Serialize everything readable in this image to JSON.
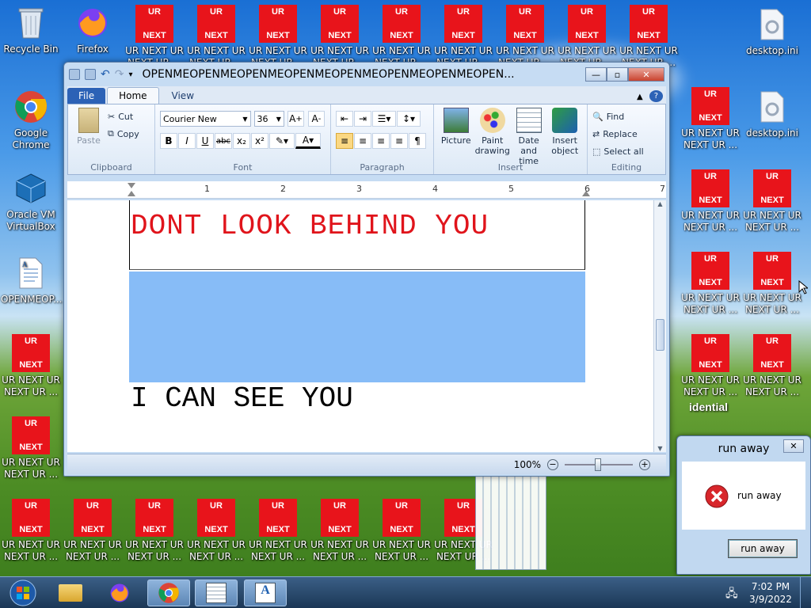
{
  "desktop": {
    "system_icons": [
      {
        "label": "Recycle Bin",
        "icon": "recycle-bin-icon"
      },
      {
        "label": "Firefox",
        "icon": "firefox-icon"
      },
      {
        "label": "Google Chrome",
        "icon": "chrome-icon"
      },
      {
        "label": "Oracle VM VirtualBox",
        "icon": "virtualbox-icon"
      },
      {
        "label": "OPENMEOP...",
        "icon": "document-file-icon"
      },
      {
        "label": "desktop.ini",
        "icon": "settings-file-icon"
      }
    ],
    "ur_icon": {
      "top_text": "UR",
      "bottom_text": "NEXT",
      "label": "UR NEXT UR NEXT UR ...",
      "color": "#e8141b"
    },
    "partial_text": "idential"
  },
  "wordpad": {
    "title": "OPENMEOPENMEOPENMEOPENMEOPENMEOPENMEOPENMEOPEN...",
    "tabs": {
      "file": "File",
      "home": "Home",
      "view": "View"
    },
    "clipboard": {
      "paste": "Paste",
      "cut": "Cut",
      "copy": "Copy",
      "label": "Clipboard"
    },
    "font": {
      "family": "Courier New",
      "size": "36",
      "label": "Font"
    },
    "paragraph": {
      "label": "Paragraph"
    },
    "insert": {
      "picture": "Picture",
      "paint": "Paint drawing",
      "datetime": "Date and time",
      "object": "Insert object",
      "label": "Insert"
    },
    "editing": {
      "find": "Find",
      "replace": "Replace",
      "select_all": "Select all",
      "label": "Editing"
    },
    "ruler": [
      "1",
      "2",
      "3",
      "4",
      "5",
      "6",
      "7"
    ],
    "document": {
      "line1": "DONT LOOK BEHIND YOU",
      "line2": "I CAN SEE YOU",
      "text_color": "#e0141b",
      "image_color": "#87bcf7"
    },
    "zoom": "100%"
  },
  "message_box": {
    "title": "run away",
    "message": "run away",
    "button": "run away"
  },
  "taskbar": {
    "time": "7:02 PM",
    "date": "3/9/2022"
  }
}
